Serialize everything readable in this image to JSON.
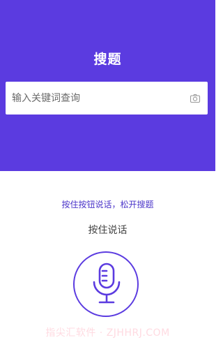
{
  "header": {
    "title": "搜题",
    "background_color": "#5b3be0"
  },
  "search": {
    "placeholder": "输入关键词查询",
    "value": "",
    "icon": "camera-icon"
  },
  "voice": {
    "hint": "按住按钮说话，松开搜题",
    "hold_label": "按住说话",
    "icon": "microphone-icon"
  },
  "watermark": {
    "text": "指尖汇软件 · ZJHHRJ.COM"
  },
  "colors": {
    "accent": "#5b3be0",
    "hint_text": "#4b35c9"
  }
}
